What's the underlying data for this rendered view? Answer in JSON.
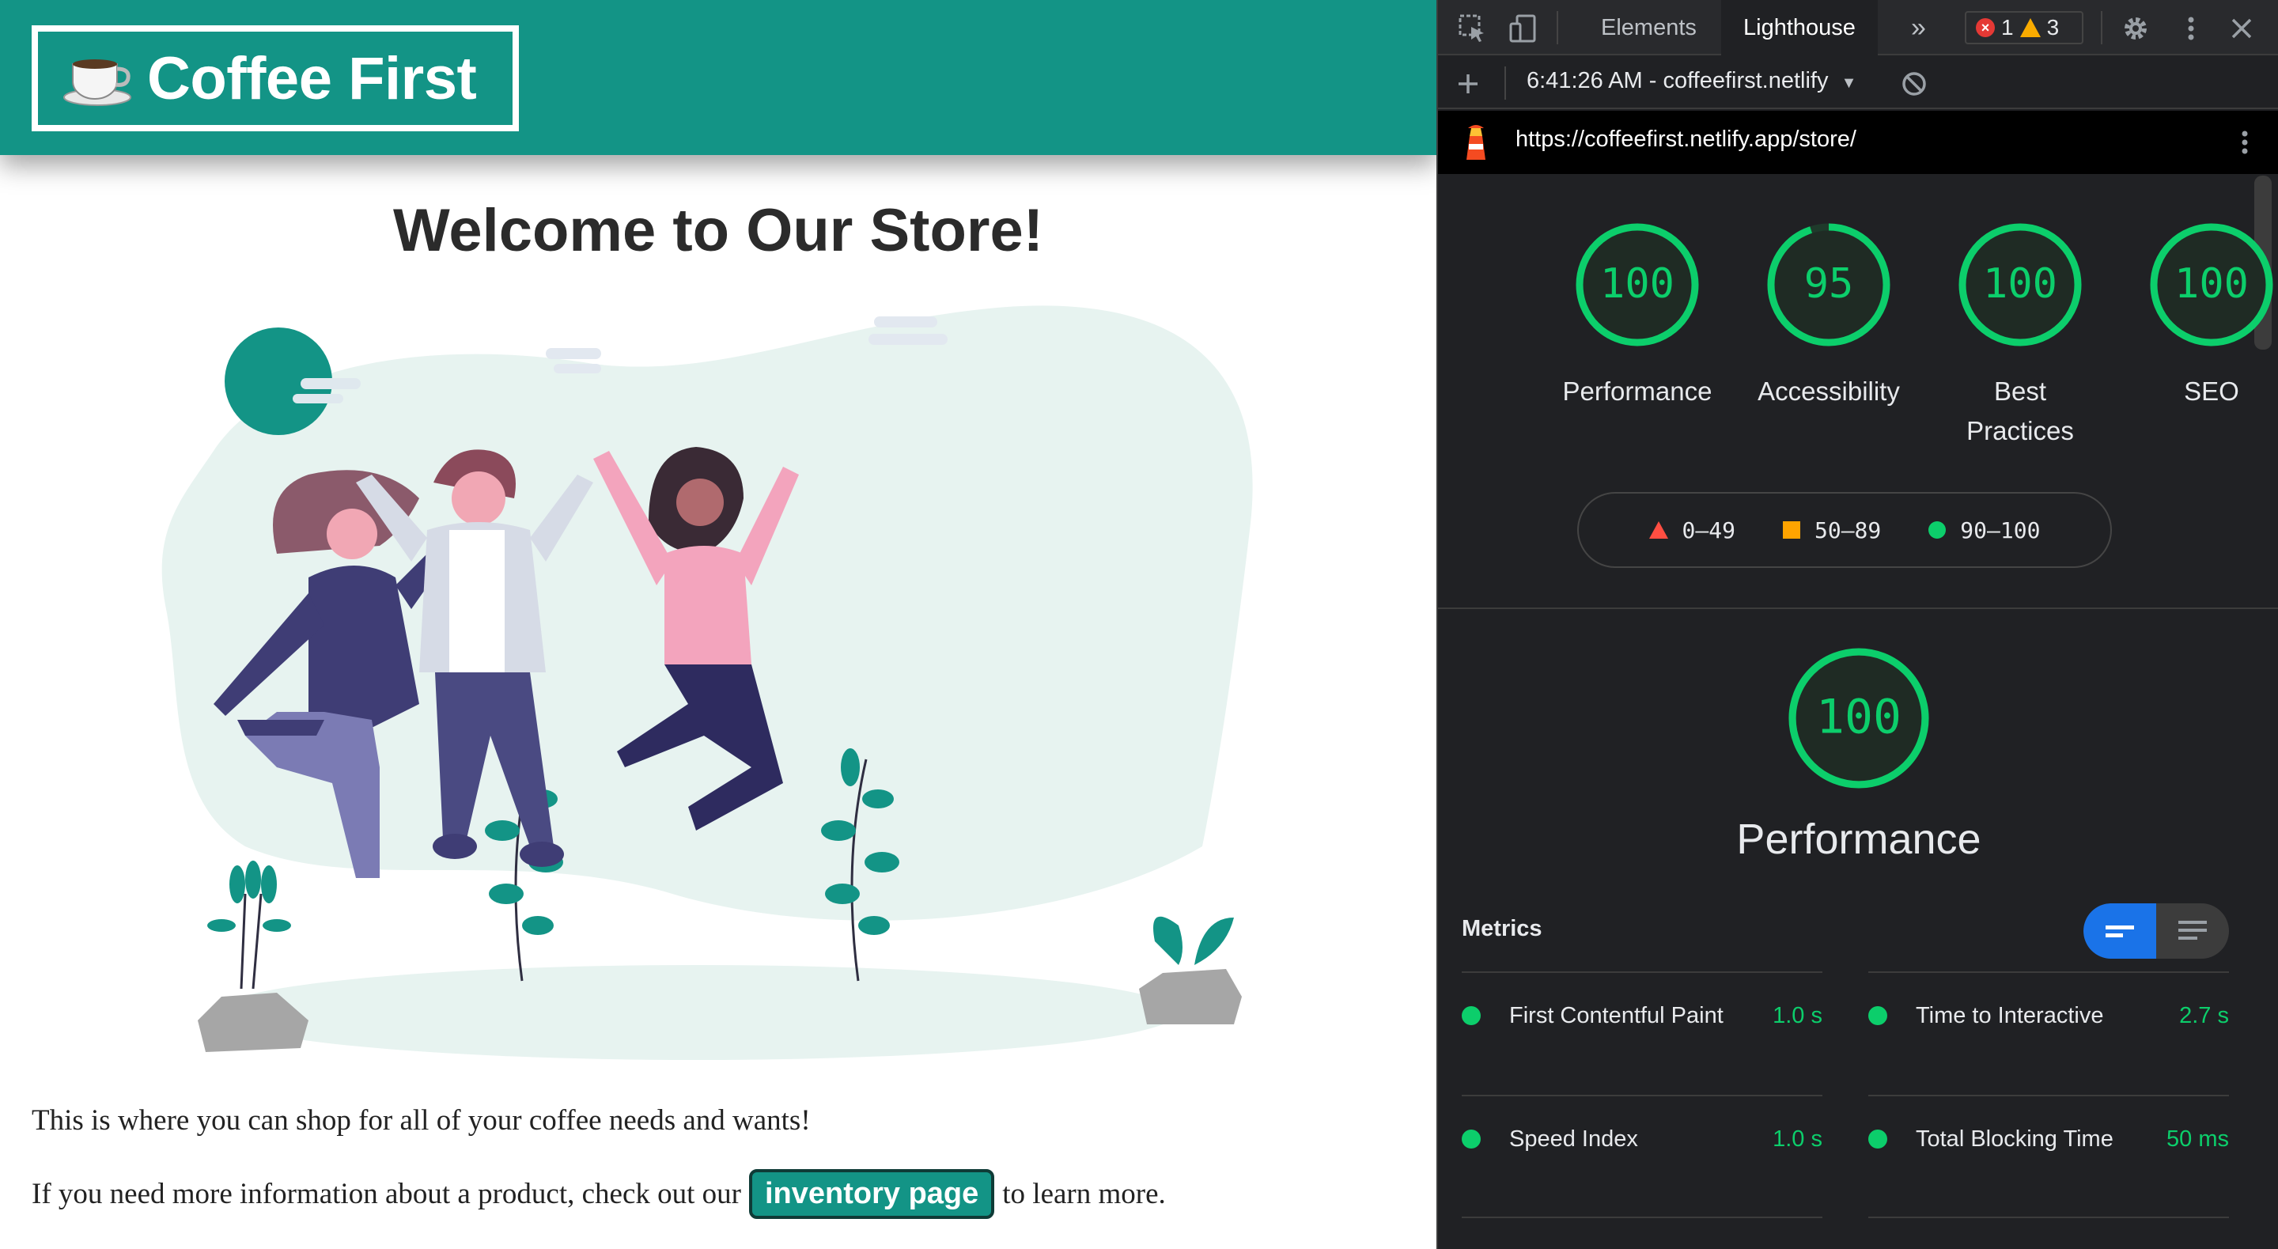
{
  "site": {
    "logo_text": "Coffee First",
    "title": "Welcome to Our Store!",
    "para1": "This is where you can shop for all of your coffee needs and wants!",
    "para2_before": "If you need more information about a product, check out our",
    "link_label": "inventory page",
    "para2_after": "to learn more."
  },
  "devtools": {
    "tabs": [
      "Elements",
      "Lighthouse"
    ],
    "active_tab": "Lighthouse",
    "error_count": "1",
    "warning_count": "3",
    "report_selector": "6:41:26 AM - coffeefirst.netlify",
    "url": "https://coffeefirst.netlify.app/store/"
  },
  "scores": [
    {
      "value": 100,
      "label": "Performance"
    },
    {
      "value": 95,
      "label": "Accessibility"
    },
    {
      "value": 100,
      "label": "Best Practices"
    },
    {
      "value": 100,
      "label": "SEO"
    }
  ],
  "legend": {
    "fail": "0–49",
    "average": "50–89",
    "pass": "90–100"
  },
  "performance": {
    "score": 100,
    "label": "Performance"
  },
  "metrics": {
    "heading": "Metrics",
    "items": [
      {
        "name": "First Contentful Paint",
        "value": "1.0 s"
      },
      {
        "name": "Time to Interactive",
        "value": "2.7 s"
      },
      {
        "name": "Speed Index",
        "value": "1.0 s"
      },
      {
        "name": "Total Blocking Time",
        "value": "50 ms"
      }
    ]
  },
  "colors": {
    "brand": "#139486",
    "pass": "#0cce6b",
    "average": "#ffa400",
    "fail": "#ff4e42",
    "devtools_bg": "#202124"
  }
}
